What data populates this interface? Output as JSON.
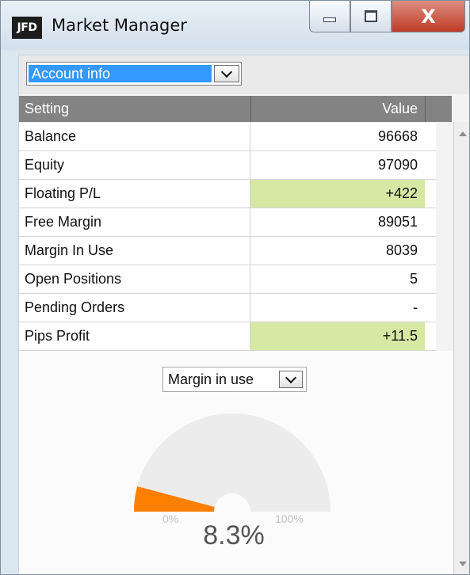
{
  "window": {
    "logo_text": "JFD",
    "title": "Market Manager",
    "close_symbol": "X"
  },
  "selector": {
    "value": "Account info"
  },
  "table": {
    "headers": [
      "Setting",
      "Value"
    ],
    "rows": [
      {
        "setting": "Balance",
        "value": "96668",
        "highlighted": false
      },
      {
        "setting": "Equity",
        "value": "97090",
        "highlighted": false
      },
      {
        "setting": "Floating P/L",
        "value": "+422",
        "highlighted": true
      },
      {
        "setting": "Free Margin",
        "value": "89051",
        "highlighted": false
      },
      {
        "setting": "Margin In Use",
        "value": "8039",
        "highlighted": false
      },
      {
        "setting": "Open Positions",
        "value": "5",
        "highlighted": false
      },
      {
        "setting": "Pending Orders",
        "value": "-",
        "highlighted": false
      },
      {
        "setting": "Pips Profit",
        "value": "+11.5",
        "highlighted": true
      }
    ]
  },
  "gauge": {
    "select_value": "Margin in use",
    "min_label": "0%",
    "max_label": "100%",
    "value_label": "8.3%",
    "fraction": 0.083
  },
  "colors": {
    "gauge_fill": "#ff7f00",
    "gauge_track": "#ececec",
    "positive_cell": "#d7e7a4",
    "selection": "#3399ff",
    "header": "#838383"
  }
}
